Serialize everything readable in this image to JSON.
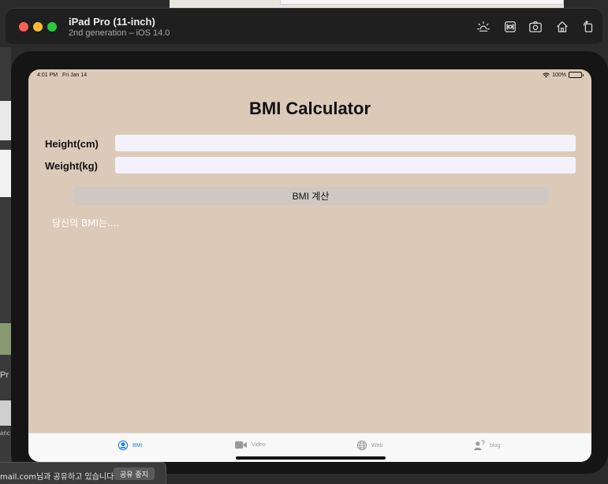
{
  "simulator": {
    "device_name": "iPad Pro (11-inch)",
    "device_subtitle": "2nd generation – iOS 14.0",
    "toolbar_icons": [
      "brightness-icon",
      "keyboard-command-icon",
      "screenshot-camera-icon",
      "home-icon",
      "rotate-icon"
    ]
  },
  "desktop": {
    "partial_text_pr": "Pr",
    "partial_text_anc": "anc"
  },
  "status_bar": {
    "time": "4:01 PM",
    "date": "Fri Jan 14",
    "battery": "100%"
  },
  "app": {
    "title": "BMI Calculator",
    "height_label": "Height(cm)",
    "weight_label": "Weight(kg)",
    "height_value": "",
    "weight_value": "",
    "calculate_button": "BMI 계산",
    "result_text": "당신의 BMI는...."
  },
  "tab_bar": {
    "tabs": [
      {
        "label": "BMI",
        "icon": "person-circle-icon",
        "selected": true
      },
      {
        "label": "Video",
        "icon": "video-camera-icon",
        "selected": false
      },
      {
        "label": "Web",
        "icon": "globe-icon",
        "selected": false
      },
      {
        "label": "blog",
        "icon": "person-question-icon",
        "selected": false
      }
    ]
  },
  "share_banner": {
    "text": "mail.com님과 공유하고 있습니다.",
    "stop_button": "공유 중지"
  },
  "colors": {
    "screen_background": "#dccab8",
    "selected_tab": "#1e7ff0",
    "input_background": "#f3f2fa"
  }
}
